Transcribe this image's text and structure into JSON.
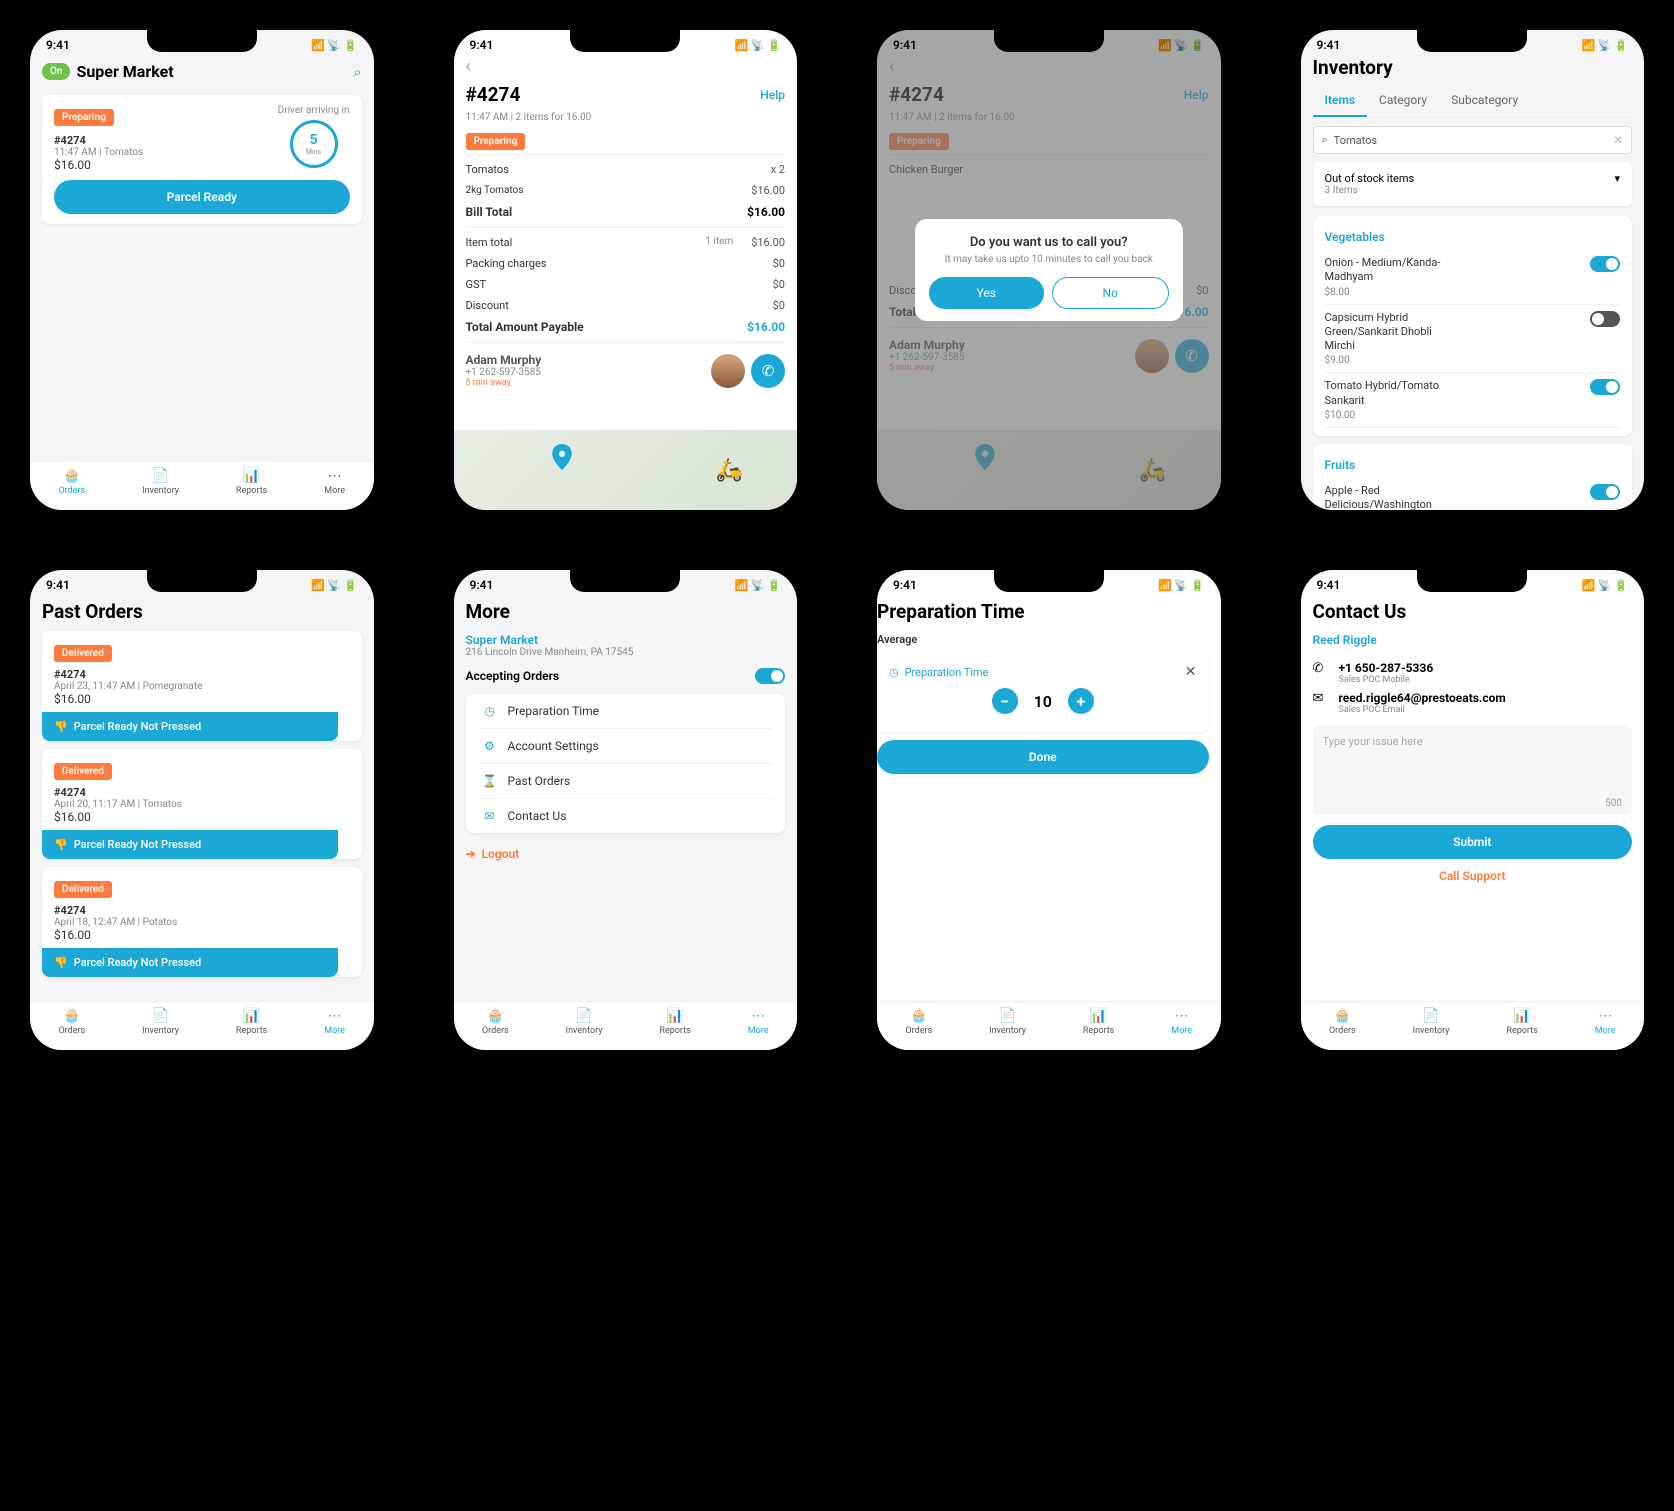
{
  "statusbar": {
    "time": "9:41",
    "signal": "▮▮▮▮",
    "wifi": "✓",
    "battery": "▬"
  },
  "tabbar": {
    "orders": "Orders",
    "inventory": "Inventory",
    "reports": "Reports",
    "more": "More"
  },
  "s1": {
    "on": "On",
    "title": "Super Market",
    "preparing": "Preparing",
    "order_id": "#4274",
    "meta": "11:47 AM |  Tomatos",
    "price": "$16.00",
    "arriving_label": "Driver arriving in",
    "ring_value": "5",
    "ring_unit": "Mins",
    "cta": "Parcel Ready"
  },
  "s2": {
    "order_id": "#4274",
    "help": "Help",
    "meta": "11:47 AM | 2 items for 16.00",
    "preparing": "Preparing",
    "line1_name": "Tomatos",
    "line1_qty": "x 2",
    "line2_desc": "2kg Tomatos",
    "line2_price": "$16.00",
    "bill_total_label": "Bill Total",
    "bill_total": "$16.00",
    "item_total_label": "Item total",
    "item_count": "1 item",
    "item_total": "$16.00",
    "packing_label": "Packing charges",
    "packing": "$0",
    "gst_label": "GST",
    "gst": "$0",
    "discount_label": "Discount",
    "discount": "$0",
    "total_payable_label": "Total Amount Payable",
    "total_payable": "$16.00",
    "driver_name": "Adam Murphy",
    "driver_phone": "+1 262-597-3585",
    "driver_eta": "5 min away"
  },
  "s3": {
    "dialog_title": "Do you want us to call you?",
    "dialog_sub": "It may take us upto 10 minutes to call you back",
    "yes": "Yes",
    "no": "No",
    "item1": "Chicken Burger"
  },
  "s4": {
    "title": "Inventory",
    "tab_items": "Items",
    "tab_category": "Category",
    "tab_subcat": "Subcategory",
    "search_value": "Tomatos",
    "filter_label": "Out of stock items",
    "filter_sub": "3 Items",
    "cat1": "Vegetables",
    "i1_name": "Onion - Medium/Kanda-Madhyam",
    "i1_price": "$8.00",
    "i1_on": true,
    "i2_name": "Capsicum Hybrid Green/Sankarit Dhobli Mirchi",
    "i2_price": "$9.00",
    "i2_on": false,
    "i3_name": "Tomato Hybrid/Tomato Sankarit",
    "i3_price": "$10.00",
    "i3_on": true,
    "cat2": "Fruits",
    "i4_name": "Apple - Red Delicious/Washington"
  },
  "s5": {
    "title": "Past Orders",
    "delivered": "Delivered",
    "o1_id": "#4274",
    "o1_meta": "April 23, 11:47 AM  |  Pomegranate",
    "o1_price": "$16.00",
    "o2_id": "#4274",
    "o2_meta": "April 20, 11:17 AM  |  Tomatos",
    "o2_price": "$16.00",
    "o3_id": "#4274",
    "o3_meta": "April 18, 12:47 AM  |  Potatos",
    "o3_price": "$16.00",
    "not_pressed": "Parcel Ready Not Pressed"
  },
  "s6": {
    "title": "More",
    "store": "Super Market",
    "address": "216 Lincoln Drive Manheim, PA 17545",
    "accepting": "Accepting Orders",
    "m1": "Preparation Time",
    "m2": "Account Settings",
    "m3": "Past Orders",
    "m4": "Contact Us",
    "logout": "Logout"
  },
  "s7": {
    "title": "Preparation Time",
    "average": "Average",
    "field_label": "Preparation Time",
    "value": "10",
    "done": "Done"
  },
  "s8": {
    "title": "Contact Us",
    "name": "Reed Riggle",
    "phone": "+1 650-287-5336",
    "phone_sub": "Sales POC Mobile",
    "email": "reed.riggle64@prestoeats.com",
    "email_sub": "Sales POC Email",
    "placeholder": "Type your issue here",
    "count": "500",
    "submit": "Submit",
    "call_support": "Call Support"
  }
}
